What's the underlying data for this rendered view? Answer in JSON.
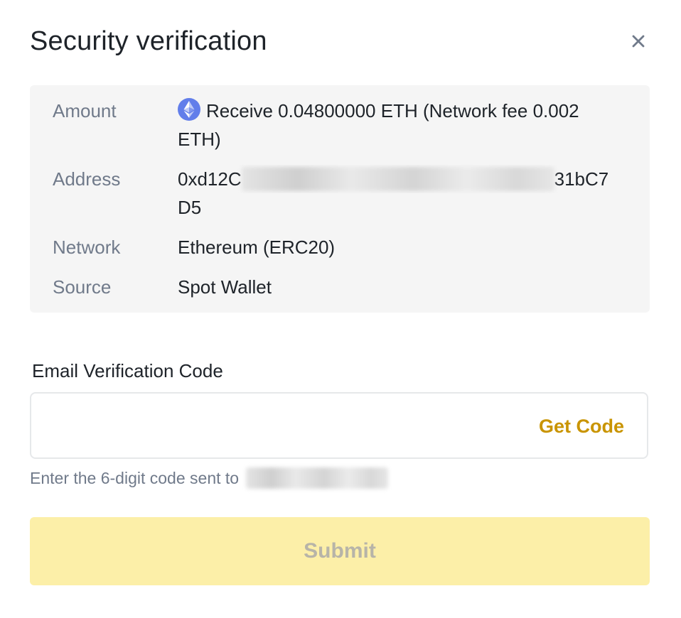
{
  "dialog": {
    "title": "Security verification",
    "close_icon": "close-icon"
  },
  "summary": {
    "amount": {
      "label": "Amount",
      "icon": "ethereum-icon",
      "value": "Receive 0.04800000 ETH (Network fee 0.002 ETH)"
    },
    "address": {
      "label": "Address",
      "value_prefix": "0xd12C",
      "value_suffix": "31bC7",
      "value_line2": "D5"
    },
    "network": {
      "label": "Network",
      "value": "Ethereum (ERC20)"
    },
    "source": {
      "label": "Source",
      "value": "Spot Wallet"
    }
  },
  "verification": {
    "label": "Email Verification Code",
    "input_value": "",
    "get_code_label": "Get Code",
    "hint": "Enter the 6-digit code sent to"
  },
  "submit": {
    "label": "Submit",
    "disabled": true
  },
  "colors": {
    "accent": "#c99400",
    "submit_bg_disabled": "#fcefa8",
    "summary_bg": "#f5f5f5",
    "muted_text": "#707a8a",
    "eth_icon": "#627eea"
  }
}
